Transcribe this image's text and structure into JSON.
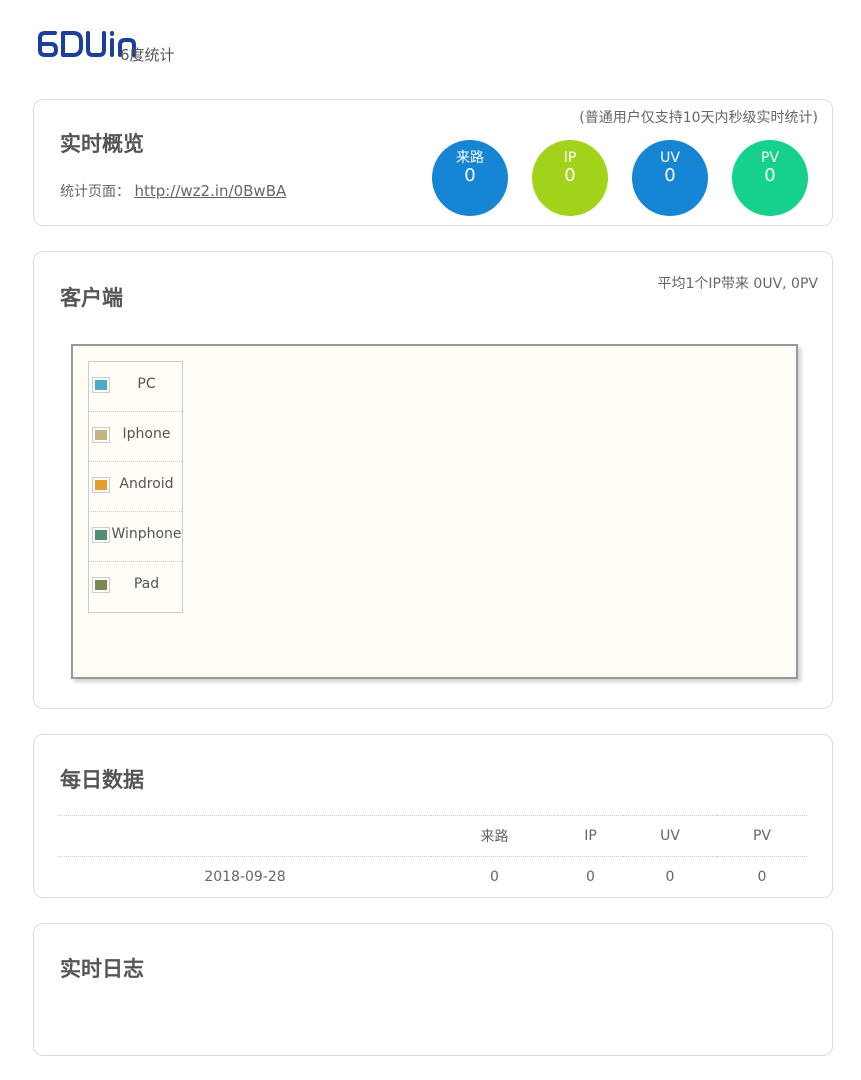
{
  "logo": {
    "sub_text": "6度统计"
  },
  "overview": {
    "title": "实时概览",
    "note": "(普通用户仅支持10天内秒级实时统计)",
    "page_label": "统计页面：",
    "page_url": "http://wz2.in/0BwBA",
    "stats": [
      {
        "label": "来路",
        "value": "0",
        "color": "#1585d4"
      },
      {
        "label": "IP",
        "value": "0",
        "color": "#a3d21a"
      },
      {
        "label": "UV",
        "value": "0",
        "color": "#1585d4"
      },
      {
        "label": "PV",
        "value": "0",
        "color": "#16d18c"
      }
    ]
  },
  "client": {
    "title": "客户端",
    "avg_note": "平均1个IP带来 0UV, 0PV",
    "legend": [
      {
        "label": "PC",
        "color": "#4bacc6"
      },
      {
        "label": "Iphone",
        "color": "#c6b47f"
      },
      {
        "label": "Android",
        "color": "#e89e2a"
      },
      {
        "label": "Winphone",
        "color": "#4f8f74"
      },
      {
        "label": "Pad",
        "color": "#7a8a50"
      }
    ]
  },
  "daily": {
    "title": "每日数据",
    "headers": [
      "",
      "来路",
      "IP",
      "UV",
      "PV"
    ],
    "rows": [
      [
        "2018-09-28",
        "0",
        "0",
        "0",
        "0"
      ]
    ]
  },
  "log": {
    "title": "实时日志"
  }
}
